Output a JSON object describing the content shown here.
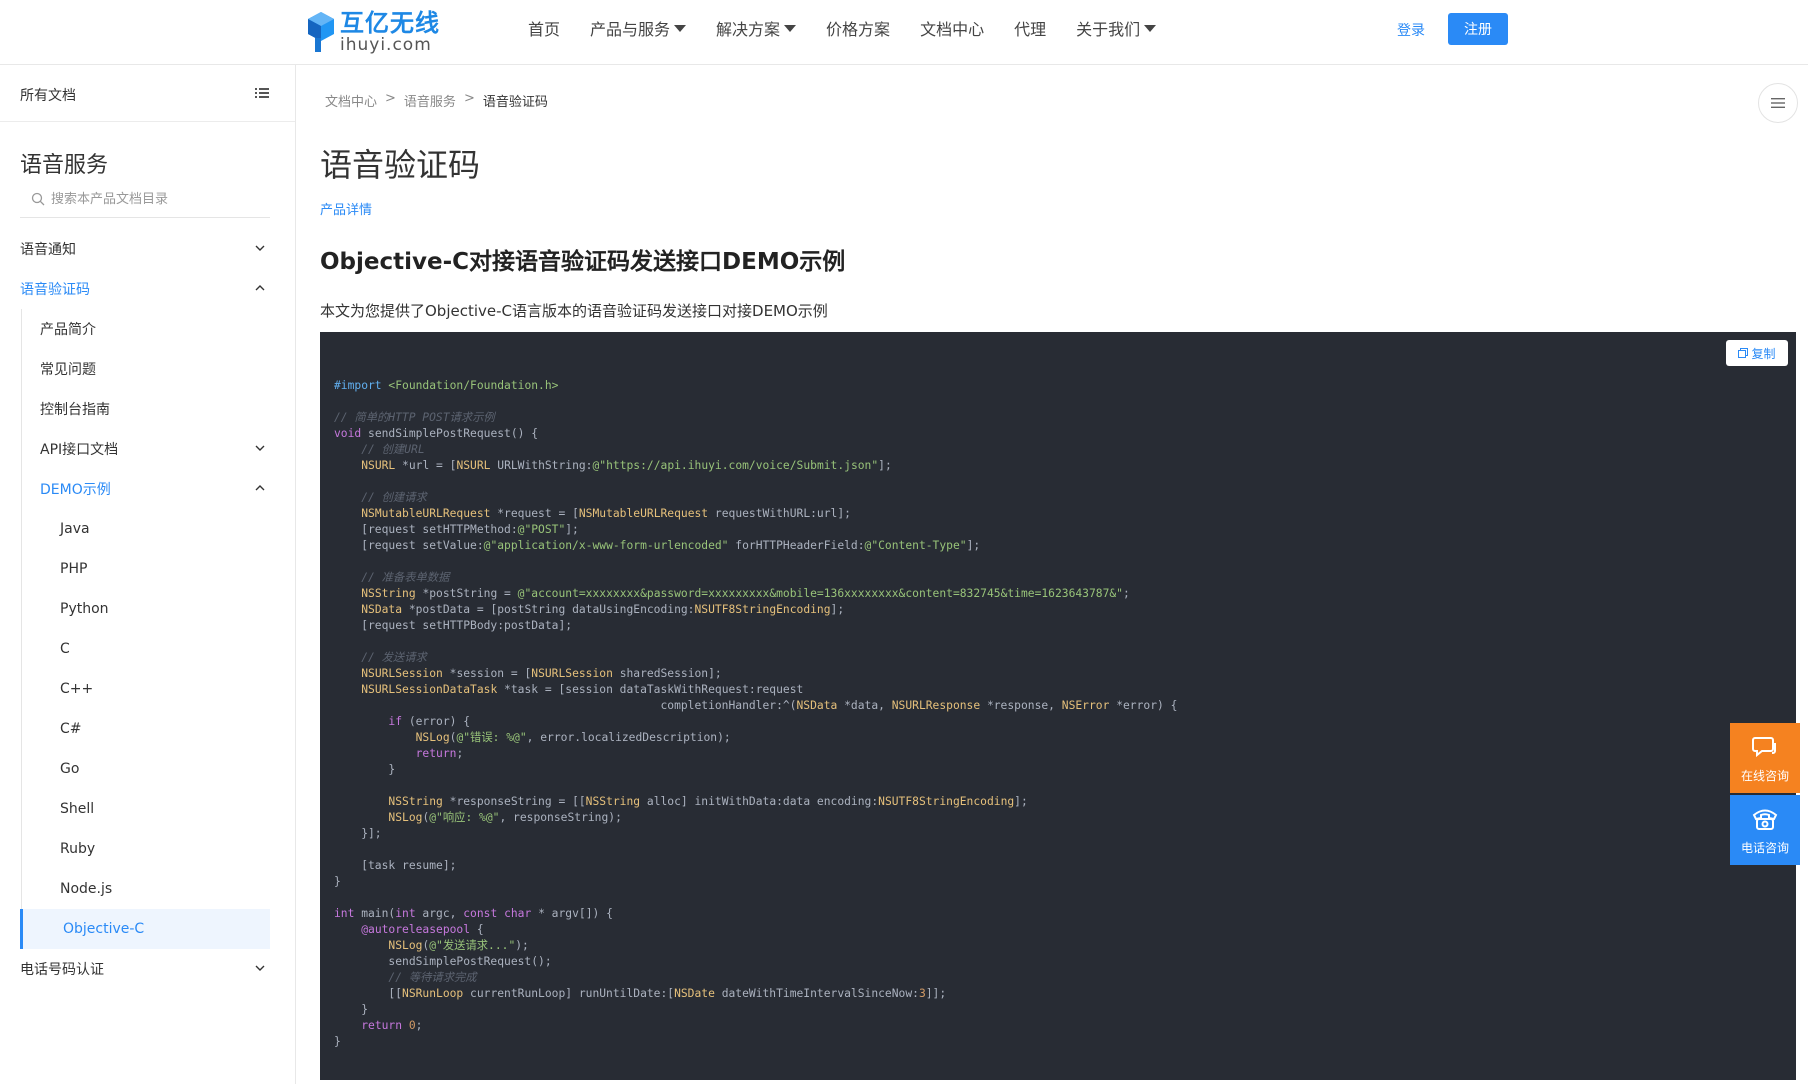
{
  "header": {
    "logo_cn": "互亿无线",
    "logo_en": "ihuyi.com",
    "nav": [
      "首页",
      "产品与服务",
      "解决方案",
      "价格方案",
      "文档中心",
      "代理",
      "关于我们"
    ],
    "login": "登录",
    "register": "注册"
  },
  "sidebar": {
    "all_docs": "所有文档",
    "title": "语音服务",
    "search_placeholder": "搜索本产品文档目录",
    "voice_notice": "语音通知",
    "voice_code": "语音验证码",
    "product_intro": "产品简介",
    "faq": "常见问题",
    "console_guide": "控制台指南",
    "api_docs": "API接口文档",
    "demo": "DEMO示例",
    "demo_langs": [
      "Java",
      "PHP",
      "Python",
      "C",
      "C++",
      "C#",
      "Go",
      "Shell",
      "Ruby",
      "Node.js",
      "Objective-C"
    ],
    "phone_auth": "电话号码认证"
  },
  "main": {
    "breadcrumb": [
      "文档中心",
      ">",
      "语音服务",
      ">",
      "语音验证码"
    ],
    "title": "语音验证码",
    "product_detail": "产品详情",
    "heading": "Objective-C对接语音验证码发送接口DEMO示例",
    "intro": "本文为您提供了Objective-C语言版本的语音验证码发送接口对接DEMO示例",
    "copy": "复制"
  },
  "floating": {
    "online": "在线咨询",
    "phone": "电话咨询"
  },
  "colors": {
    "accent": "#2a8af6",
    "code_bg": "#282c34",
    "online_bg": "#f58220"
  }
}
